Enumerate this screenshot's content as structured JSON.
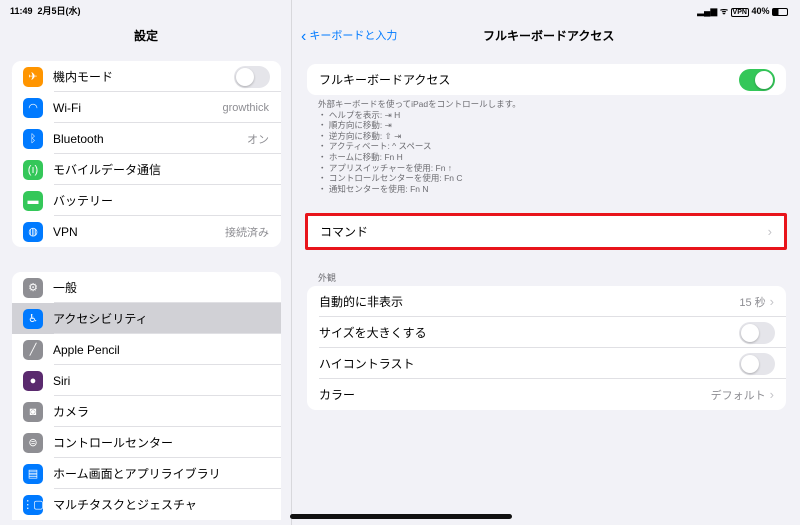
{
  "status": {
    "time": "11:49",
    "date": "2月5日(水)",
    "vpn": "VPN",
    "battery": "40%"
  },
  "sidebar": {
    "title": "設定",
    "group1": [
      {
        "label": "機内モード",
        "icon": "airplane-icon",
        "color": "#ff9500",
        "toggle": false
      },
      {
        "label": "Wi-Fi",
        "icon": "wifi-icon",
        "color": "#007aff",
        "value": "growthick"
      },
      {
        "label": "Bluetooth",
        "icon": "bluetooth-icon",
        "color": "#007aff",
        "value": "オン"
      },
      {
        "label": "モバイルデータ通信",
        "icon": "antenna-icon",
        "color": "#34c759"
      },
      {
        "label": "バッテリー",
        "icon": "battery-icon",
        "color": "#34c759"
      },
      {
        "label": "VPN",
        "icon": "globe-icon",
        "color": "#007aff",
        "value": "接続済み"
      }
    ],
    "group2": [
      {
        "label": "一般",
        "icon": "gear-icon",
        "color": "#8e8e93"
      },
      {
        "label": "アクセシビリティ",
        "icon": "accessibility-icon",
        "color": "#007aff",
        "selected": true
      },
      {
        "label": "Apple Pencil",
        "icon": "pencil-icon",
        "color": "#8e8e93"
      },
      {
        "label": "Siri",
        "icon": "siri-icon",
        "color": "#5a2a6e"
      },
      {
        "label": "カメラ",
        "icon": "camera-icon",
        "color": "#8e8e93"
      },
      {
        "label": "コントロールセンター",
        "icon": "switches-icon",
        "color": "#8e8e93"
      },
      {
        "label": "ホーム画面とアプリライブラリ",
        "icon": "home-screen-icon",
        "color": "#007aff"
      },
      {
        "label": "マルチタスクとジェスチャ",
        "icon": "multitask-icon",
        "color": "#007aff"
      }
    ]
  },
  "main": {
    "back": "キーボードと入力",
    "title": "フルキーボードアクセス",
    "toggle_label": "フルキーボードアクセス",
    "desc_intro": "外部キーボードを使ってiPadをコントロールします。",
    "desc_items": [
      "ヘルプを表示: ⇥ H",
      "順方向に移動: ⇥",
      "逆方向に移動: ⇧ ⇥",
      "アクティベート: ^ スペース",
      "ホームに移動: Fn H",
      "アプリスイッチャーを使用: Fn ↑",
      "コントロールセンターを使用: Fn C",
      "通知センターを使用: Fn N"
    ],
    "commands": "コマンド",
    "section": "外観",
    "appearance": [
      {
        "label": "自動的に非表示",
        "value": "15 秒"
      },
      {
        "label": "サイズを大きくする",
        "toggle": false
      },
      {
        "label": "ハイコントラスト",
        "toggle": false
      },
      {
        "label": "カラー",
        "value": "デフォルト"
      }
    ],
    "highlight_color": "#e8141b"
  }
}
